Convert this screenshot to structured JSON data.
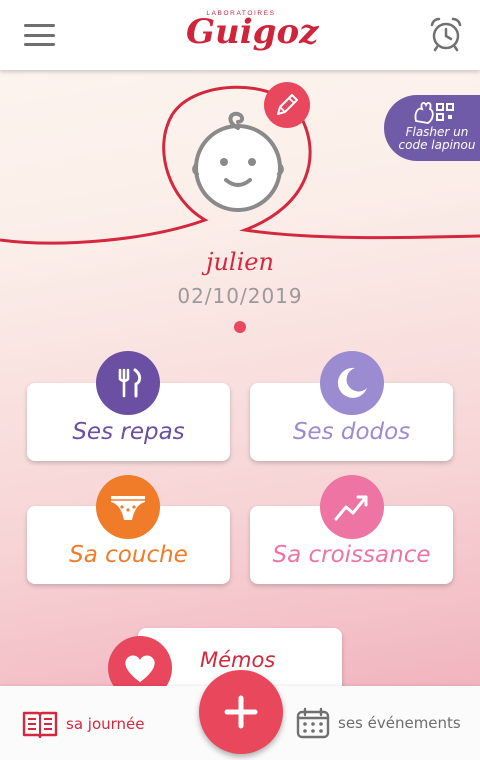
{
  "header": {
    "logo_small": "LABORATOIRES",
    "logo_main": "Guigoz"
  },
  "profile": {
    "name": "julien",
    "date": "02/10/2019"
  },
  "qr_badge": {
    "line1": "Flasher un",
    "line2": "code lapinou"
  },
  "cards": {
    "repas": {
      "label": "Ses repas",
      "color": "#6a4fa3"
    },
    "dodos": {
      "label": "Ses dodos",
      "color": "#9b8bd0"
    },
    "couche": {
      "label": "Sa couche",
      "color": "#f07c2a"
    },
    "croissance": {
      "label": "Sa croissance",
      "color": "#ee74a3"
    }
  },
  "memos": {
    "label": "Mémos",
    "color": "#e8475d"
  },
  "bottom": {
    "journal_label": "sa journée",
    "events_label": "ses événements"
  },
  "icons": [
    "menu-icon",
    "alarm-icon",
    "baby-face-icon",
    "pencil-icon",
    "qr-rabbit-icon",
    "fork-knife-icon",
    "moon-icon",
    "diaper-icon",
    "growth-chart-icon",
    "heart-icon",
    "book-icon",
    "plus-icon",
    "calendar-icon"
  ],
  "colors": {
    "brand_red": "#d4283e",
    "accent": "#e8475d",
    "purple": "#6f5ba8"
  }
}
